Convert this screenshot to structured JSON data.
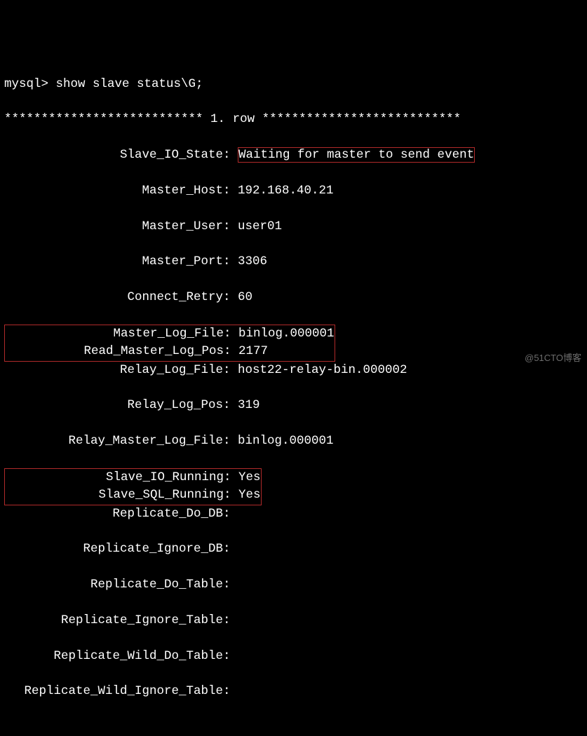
{
  "prompt": "mysql> ",
  "command": "show slave status\\G;",
  "row_header_left": "*************************** 1. ",
  "row_header_word": "row",
  "row_header_right": " ***************************",
  "fields": {
    "slave_io_state": {
      "label": "Slave_IO_State",
      "value": "Waiting for master to send event"
    },
    "master_host": {
      "label": "Master_Host",
      "value": "192.168.40.21"
    },
    "master_user": {
      "label": "Master_User",
      "value": "user01"
    },
    "master_port": {
      "label": "Master_Port",
      "value": "3306"
    },
    "connect_retry": {
      "label": "Connect_Retry",
      "value": "60"
    },
    "master_log_file": {
      "label": "Master_Log_File",
      "value": "binlog.000001"
    },
    "read_master_log_pos": {
      "label": "Read_Master_Log_Pos",
      "value": "2177"
    },
    "relay_log_file": {
      "label": "Relay_Log_File",
      "value": "host22-relay-bin.000002"
    },
    "relay_log_pos": {
      "label": "Relay_Log_Pos",
      "value": "319"
    },
    "relay_master_log_file": {
      "label": "Relay_Master_Log_File",
      "value": "binlog.000001"
    },
    "slave_io_running": {
      "label": "Slave_IO_Running",
      "value": "Yes"
    },
    "slave_sql_running": {
      "label": "Slave_SQL_Running",
      "value": "Yes"
    },
    "replicate_do_db": {
      "label": "Replicate_Do_DB",
      "value": ""
    },
    "replicate_ignore_db": {
      "label": "Replicate_Ignore_DB",
      "value": ""
    },
    "replicate_do_table": {
      "label": "Replicate_Do_Table",
      "value": ""
    },
    "replicate_ignore_table": {
      "label": "Replicate_Ignore_Table",
      "value": ""
    },
    "replicate_wild_do_table": {
      "label": "Replicate_Wild_Do_Table",
      "value": ""
    },
    "replicate_wild_ignore_table": {
      "label": "Replicate_Wild_Ignore_Table",
      "value": ""
    }
  },
  "watermark": "@51CTO博客"
}
